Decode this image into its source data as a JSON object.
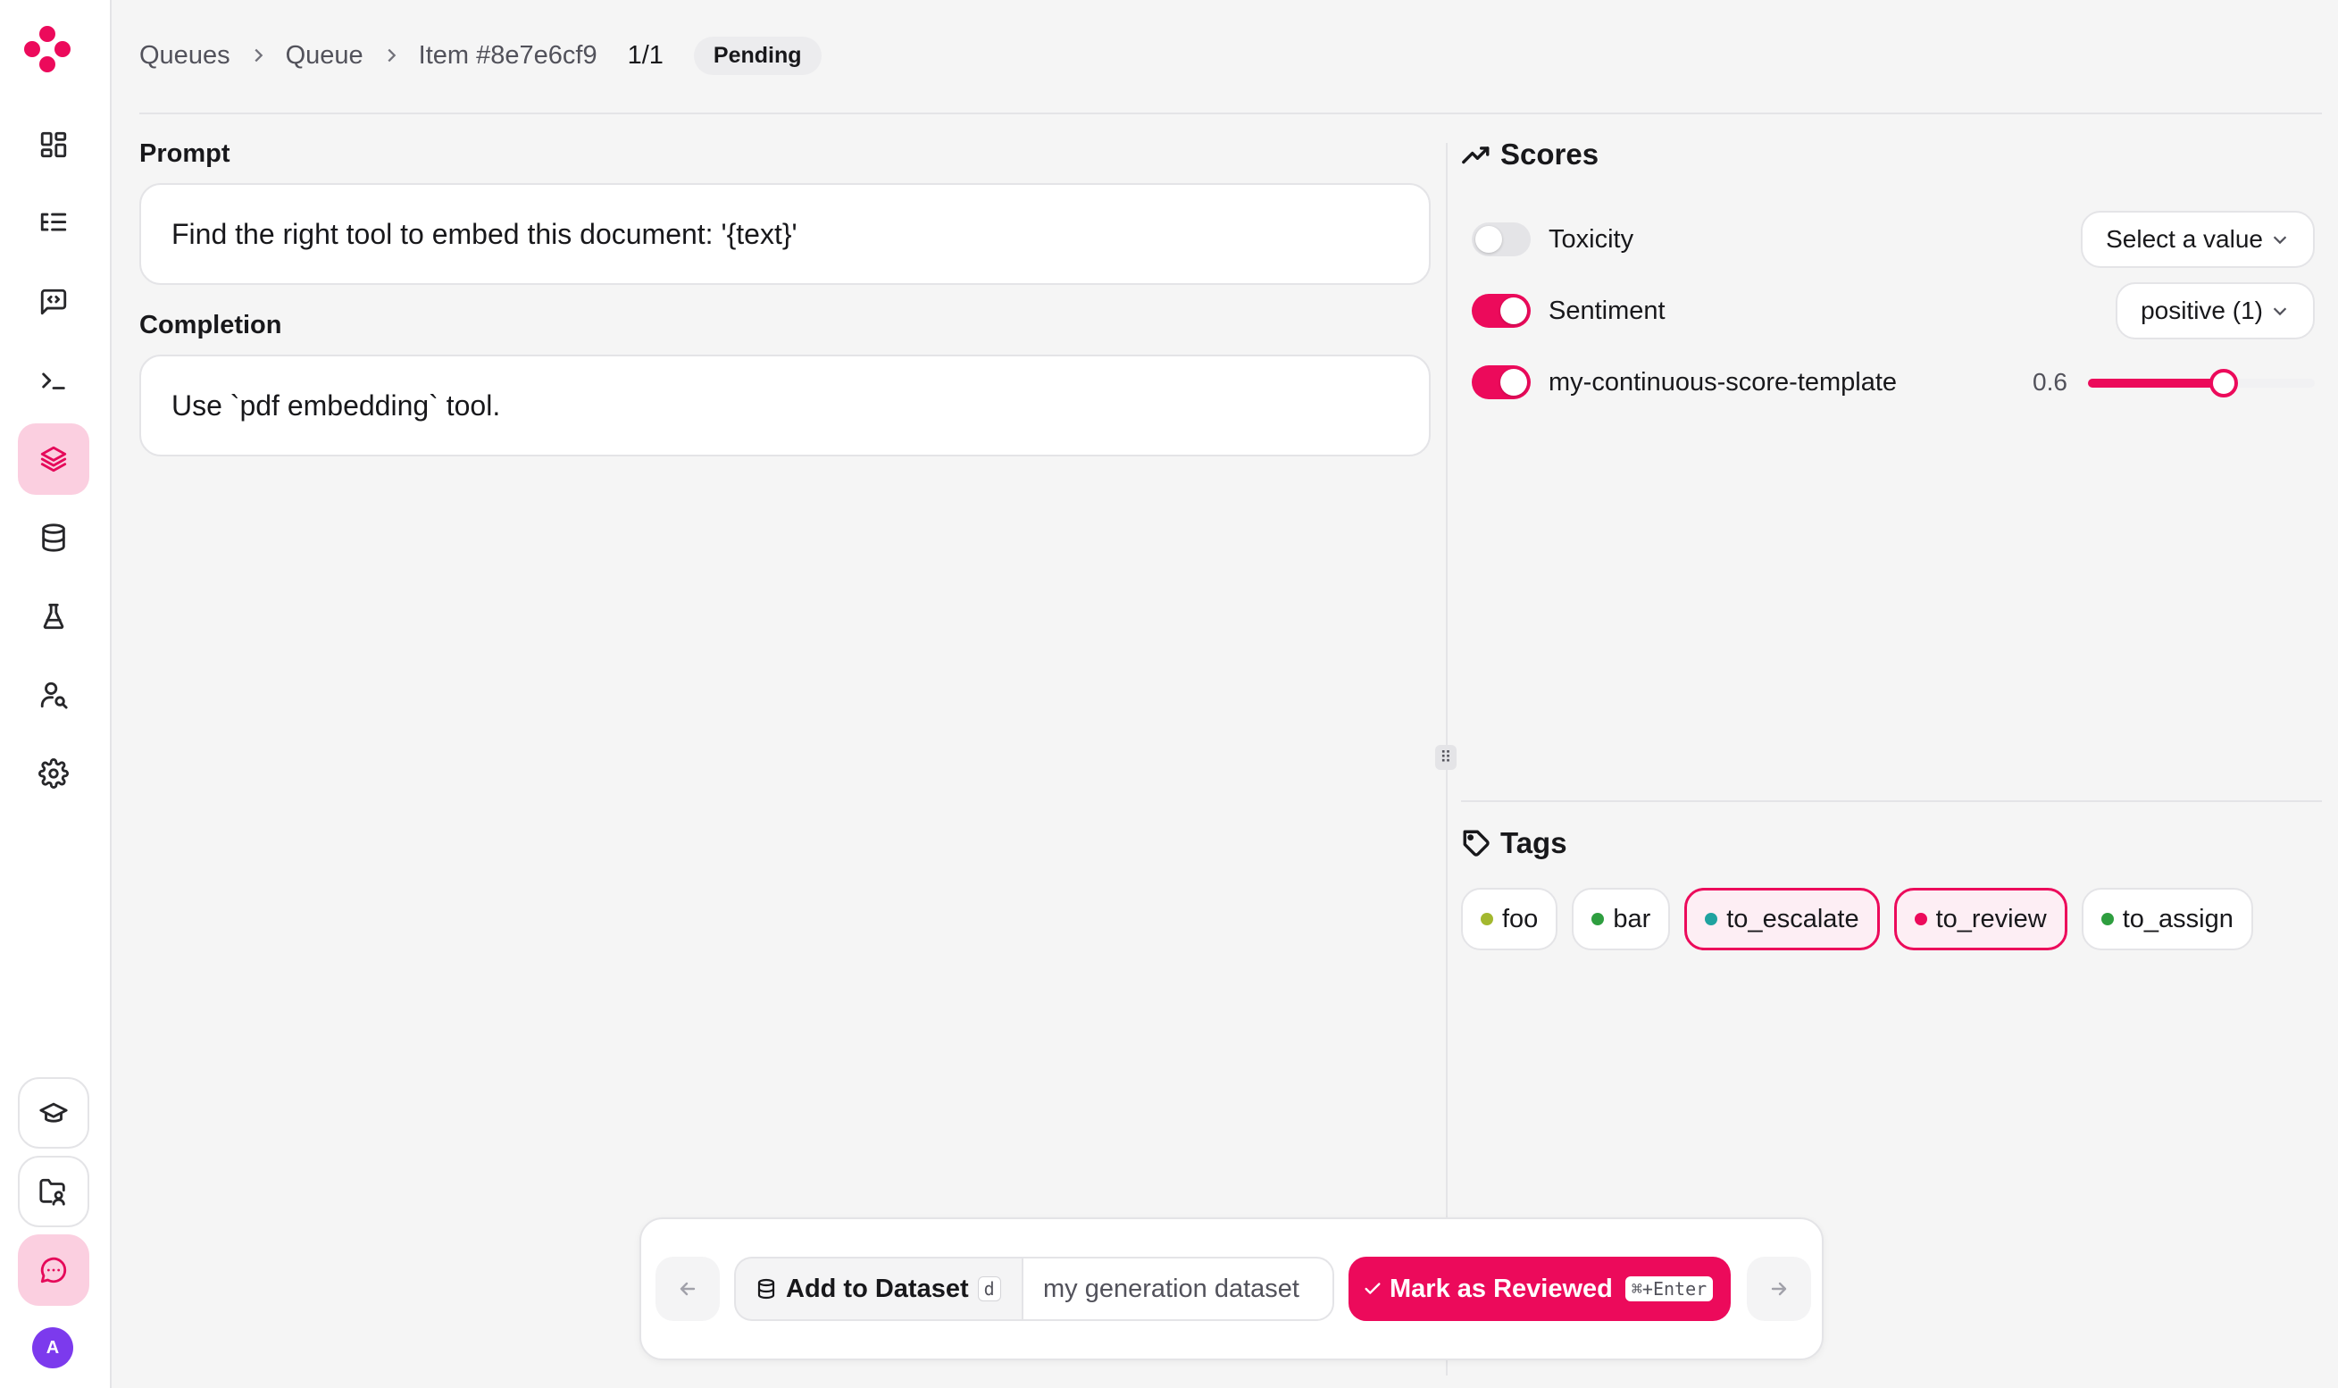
{
  "breadcrumb": {
    "queues": "Queues",
    "queue": "Queue",
    "item": "Item #8e7e6cf9",
    "counter": "1/1",
    "status": "Pending"
  },
  "prompt": {
    "label": "Prompt",
    "text": "Find the right tool to embed this document: '{text}'"
  },
  "completion": {
    "label": "Completion",
    "text": "Use `pdf embedding` tool."
  },
  "scores": {
    "title": "Scores",
    "items": [
      {
        "name": "Toxicity",
        "enabled": false,
        "value": "Select a value"
      },
      {
        "name": "Sentiment",
        "enabled": true,
        "value": "positive (1)"
      },
      {
        "name": "my-continuous-score-template",
        "enabled": true,
        "value": "0.6",
        "level": 0.6
      }
    ]
  },
  "tags": {
    "title": "Tags",
    "items": [
      {
        "label": "foo",
        "color": "#a3b82f",
        "selected": false
      },
      {
        "label": "bar",
        "color": "#2e9e3f",
        "selected": false
      },
      {
        "label": "to_escalate",
        "color": "#1fa3a0",
        "selected": true
      },
      {
        "label": "to_review",
        "color": "#ec0a5b",
        "selected": true
      },
      {
        "label": "to_assign",
        "color": "#2e9e3f",
        "selected": false
      }
    ]
  },
  "actions": {
    "add_to_dataset": "Add to Dataset",
    "add_to_dataset_shortcut": "d",
    "dataset_name": "my generation dataset",
    "mark_reviewed": "Mark as Reviewed",
    "mark_reviewed_shortcut": "⌘+Enter"
  },
  "user": {
    "avatar_initial": "A"
  },
  "colors": {
    "accent": "#ec0a5b",
    "accent_light": "#fbcfe0",
    "background": "#f5f5f5"
  }
}
